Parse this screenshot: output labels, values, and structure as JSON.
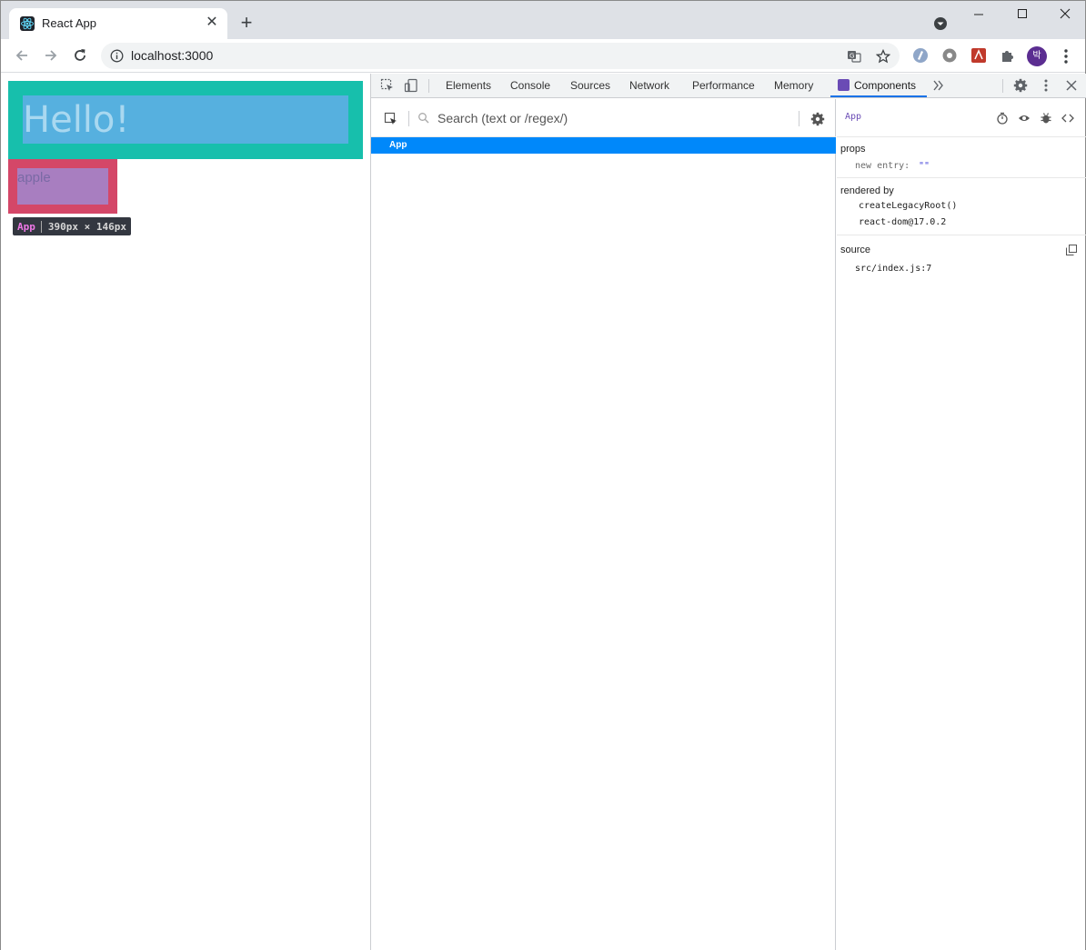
{
  "browser": {
    "tab": {
      "title": "React App"
    },
    "address": {
      "url": "localhost:3000"
    },
    "profile_initial": "박"
  },
  "page": {
    "heading": "Hello!",
    "item": "apple",
    "inspect_tooltip": {
      "component": "App",
      "size": "390px × 146px"
    },
    "colors": {
      "outer": "#17bfac",
      "inner": "#56b0df",
      "apple_outer": "#d44768",
      "apple_inner": "#a87ec0"
    }
  },
  "devtools": {
    "tabs": [
      "Elements",
      "Console",
      "Sources",
      "Network",
      "Performance",
      "Memory",
      "Components"
    ],
    "active_tab": "Components",
    "search_placeholder": "Search (text or /regex/)",
    "tree": [
      {
        "name": "App",
        "selected": true
      }
    ],
    "inspector": {
      "component": "App",
      "props_title": "props",
      "props": [
        {
          "key": "new entry:",
          "value": "\"\""
        }
      ],
      "rendered_by_title": "rendered by",
      "rendered_by": [
        "createLegacyRoot()",
        "react-dom@17.0.2"
      ],
      "source_title": "source",
      "source": "src/index.js:7"
    }
  }
}
